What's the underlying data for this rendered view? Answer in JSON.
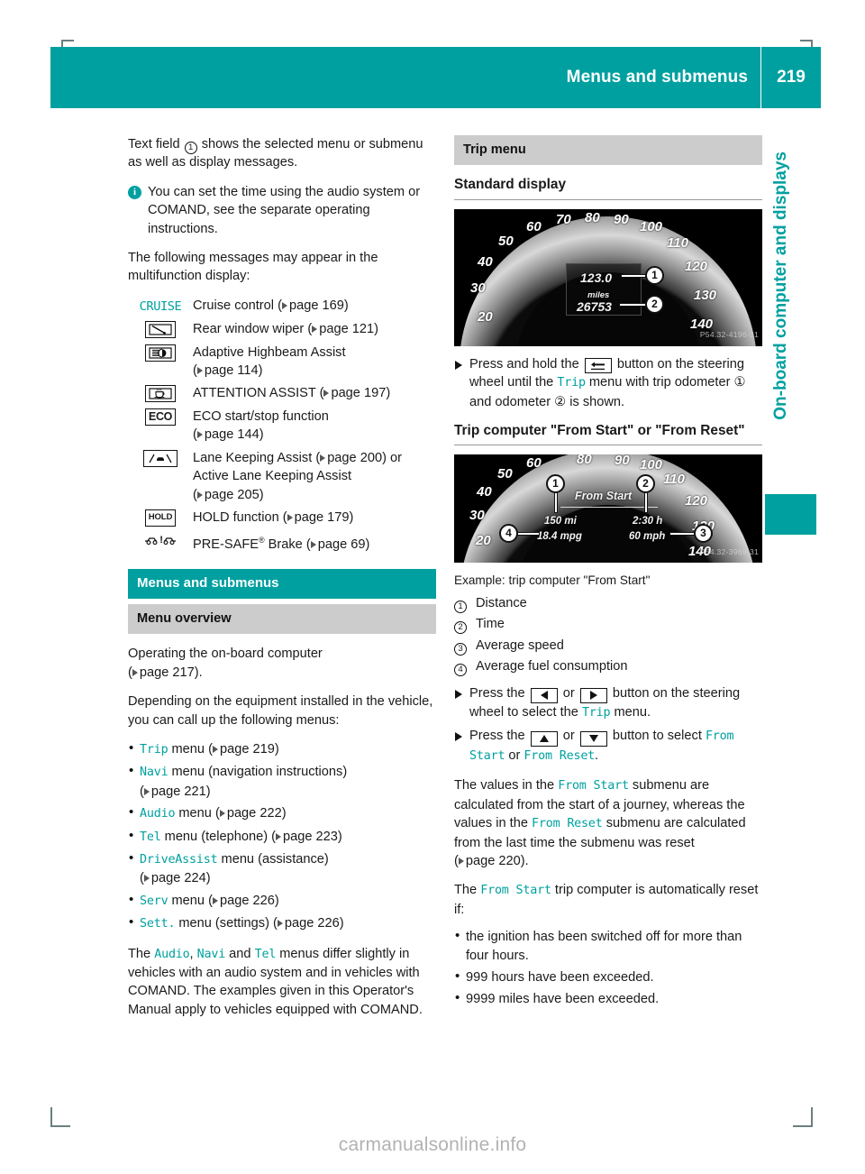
{
  "header": {
    "title": "Menus and submenus",
    "page_number": "219",
    "accent_color": "#00a0a0"
  },
  "side_tab": {
    "label": "On-board computer and displays"
  },
  "watermark": "carmanualsonline.info",
  "left_column": {
    "intro": "Text field ① shows the selected menu or submenu as well as display messages.",
    "intro_part1": "Text field",
    "intro_part2": "shows the selected menu or submenu as well as display messages.",
    "note": "You can set the time using the audio system or COMAND, see the separate operating instructions.",
    "messages_intro": "The following messages may appear in the multifunction display:",
    "messages": [
      {
        "icon": "cruise-text-icon",
        "icon_label": "CRUISE",
        "text": "Cruise control",
        "page": "page 169"
      },
      {
        "icon": "rear-window-wiper-icon",
        "icon_label": "",
        "text": "Rear window wiper",
        "page": "page 121"
      },
      {
        "icon": "adaptive-highbeam-icon",
        "icon_label": "",
        "text": "Adaptive Highbeam Assist",
        "page": "page 114"
      },
      {
        "icon": "attention-assist-coffee-icon",
        "icon_label": "",
        "text": "ATTENTION ASSIST",
        "page": "page 197"
      },
      {
        "icon": "eco-icon",
        "icon_label": "ECO",
        "text": "ECO start/stop function",
        "page": "page 144"
      },
      {
        "icon": "lane-keeping-assist-icon",
        "icon_label": "",
        "text": "Lane Keeping Assist",
        "page": "page 200",
        "text2": "or Active Lane Keeping Assist",
        "page2": "page 205"
      },
      {
        "icon": "hold-icon",
        "icon_label": "HOLD",
        "text": "HOLD function",
        "page": "page 179"
      },
      {
        "icon": "pre-safe-brake-icon",
        "icon_label": "",
        "text": "PRE-SAFE® Brake",
        "page": "page 69"
      }
    ],
    "section_bar": "Menus and submenus",
    "subsection_bar": "Menu overview",
    "operating_text": "Operating the on-board computer",
    "operating_page": "page 217",
    "depending_text": "Depending on the equipment installed in the vehicle, you can call up the following menus:",
    "menu_list": [
      {
        "name": "Trip",
        "desc": "menu",
        "page": "page 219"
      },
      {
        "name": "Navi",
        "desc": "menu (navigation instructions)",
        "page": "page 221"
      },
      {
        "name": "Audio",
        "desc": "menu",
        "page": "page 222"
      },
      {
        "name": "Tel",
        "desc": "menu (telephone)",
        "page": "page 223"
      },
      {
        "name": "DriveAssist",
        "desc": "menu (assistance)",
        "page": "page 224"
      },
      {
        "name": "Serv",
        "desc": "menu",
        "page": "page 226"
      },
      {
        "name": "Sett.",
        "desc": "menu (settings)",
        "page": "page 226"
      }
    ],
    "closing_a": "The",
    "closing_m1": "Audio",
    "closing_b": ",",
    "closing_m2": "Navi",
    "closing_c": "and",
    "closing_m3": "Tel",
    "closing_d": "menus differ slightly in vehicles with an audio system and in vehicles with COMAND. The examples given in this Operator's Manual apply to vehicles equipped with COMAND."
  },
  "right_column": {
    "trip_menu_bar": "Trip menu",
    "standard_display_heading": "Standard display",
    "standard_cluster": {
      "speed_ticks": [
        "20",
        "30",
        "40",
        "50",
        "60",
        "70",
        "80",
        "90",
        "100",
        "110",
        "120",
        "130",
        "140"
      ],
      "trip_odometer": "123.0",
      "unit": "miles",
      "odometer": "26753",
      "callouts": [
        "1",
        "2"
      ],
      "image_code": "P54.32-4196-31"
    },
    "step_standard_a": "Press and hold the",
    "step_standard_b": "button on the steering wheel until the",
    "step_standard_menu": "Trip",
    "step_standard_c": "menu with trip odometer ① and odometer ② is shown.",
    "trip_computer_heading": "Trip computer \"From Start\" or \"From Reset\"",
    "trip_cluster": {
      "title": "From Start",
      "distance": "150 mi",
      "time": "2:30 h",
      "consumption": "18.4 mpg",
      "avg_speed": "60 mph",
      "callouts": [
        "1",
        "2",
        "3",
        "4"
      ],
      "image_code": "P54.32-3969-31"
    },
    "example_caption": "Example: trip computer \"From Start\"",
    "legend": [
      {
        "num": "1",
        "label": "Distance"
      },
      {
        "num": "2",
        "label": "Time"
      },
      {
        "num": "3",
        "label": "Average speed"
      },
      {
        "num": "4",
        "label": "Average fuel consumption"
      }
    ],
    "step1_a": "Press the",
    "step1_or": "or",
    "step1_b": "button on the steering wheel to select the",
    "step1_menu": "Trip",
    "step1_c": "menu.",
    "step2_a": "Press the",
    "step2_or": "or",
    "step2_b": "button to select",
    "step2_m1": "From Start",
    "step2_or2": "or",
    "step2_m2": "From Reset",
    "step2_end": ".",
    "values_a": "The values in the",
    "values_m1": "From Start",
    "values_b": "submenu are calculated from the start of a journey, whereas the values in the",
    "values_m2": "From Reset",
    "values_c": "submenu are calculated from the last time the submenu was reset",
    "values_page": "page 220",
    "reset_a": "The",
    "reset_m": "From Start",
    "reset_b": "trip computer is automatically reset if:",
    "reset_list": [
      "the ignition has been switched off for more than four hours.",
      "999 hours have been exceeded.",
      "9999 miles have been exceeded."
    ]
  }
}
